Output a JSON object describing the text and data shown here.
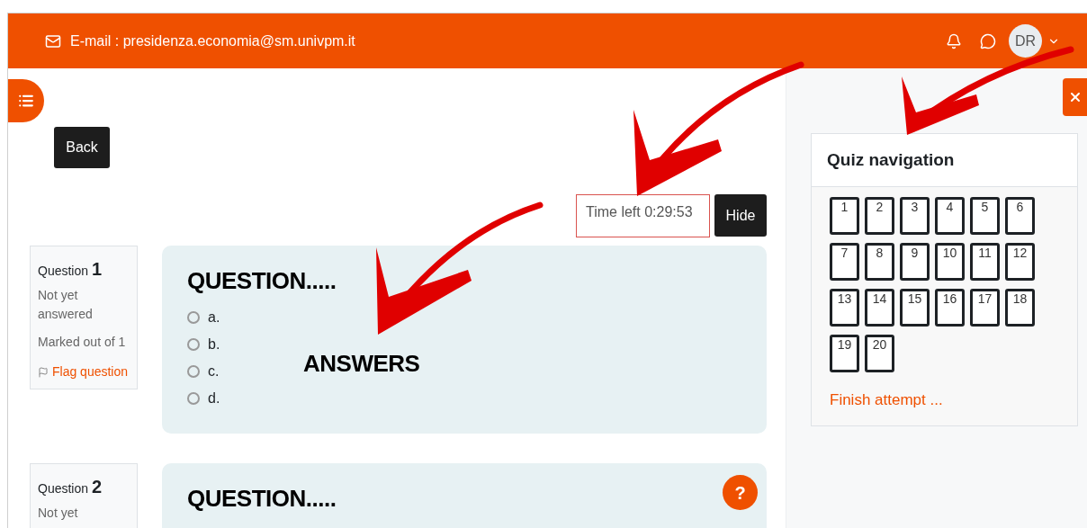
{
  "header": {
    "email": "E-mail : presidenza.economia@sm.univpm.it",
    "avatar": "DR"
  },
  "back_button": "Back",
  "timer": {
    "text": "Time left 0:29:53",
    "hide_button": "Hide"
  },
  "questions": [
    {
      "label": "Question",
      "number": "1",
      "status": "Not yet answered",
      "marks": "Marked out of 1",
      "flag": "Flag question",
      "title": "QUESTION.....",
      "annotation": "ANSWERS",
      "options": [
        {
          "label": "a.",
          "checked": false
        },
        {
          "label": "b.",
          "checked": false
        },
        {
          "label": "c.",
          "checked": false
        },
        {
          "label": "d.",
          "checked": false
        }
      ]
    },
    {
      "label": "Question",
      "number": "2",
      "status": "Not yet",
      "title": "QUESTION....."
    }
  ],
  "help_button": "?",
  "quiz_navigation": {
    "title": "Quiz navigation",
    "buttons": [
      "1",
      "2",
      "3",
      "4",
      "5",
      "6",
      "7",
      "8",
      "9",
      "10",
      "11",
      "12",
      "13",
      "14",
      "15",
      "16",
      "17",
      "18",
      "19",
      "20"
    ],
    "finish_link": "Finish attempt ..."
  }
}
